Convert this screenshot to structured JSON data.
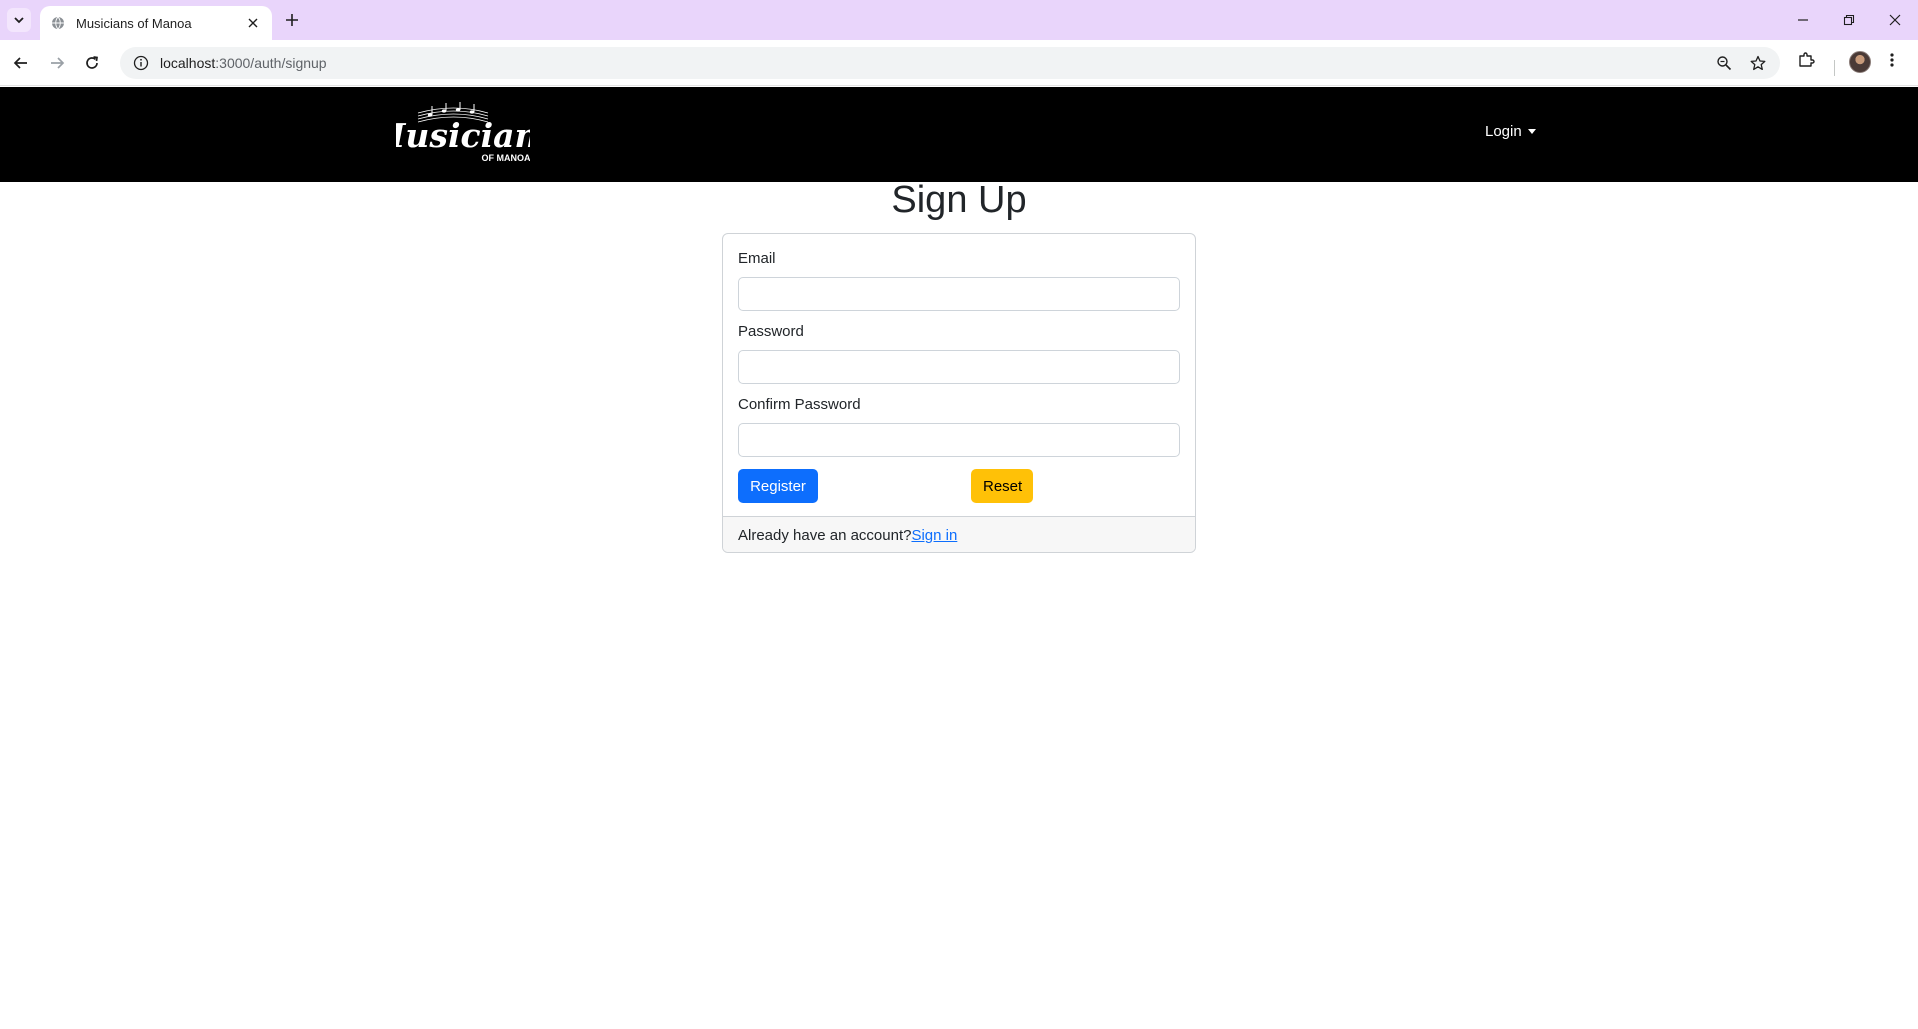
{
  "browser": {
    "tab_title": "Musicians of Manoa",
    "url_host": "localhost",
    "url_path": ":3000/auth/signup"
  },
  "navbar": {
    "brand_main": "Musicians",
    "brand_sub": "OF MANOA",
    "login_label": "Login"
  },
  "page": {
    "heading": "Sign Up"
  },
  "form": {
    "email_label": "Email",
    "email_value": "",
    "password_label": "Password",
    "password_value": "",
    "confirm_label": "Confirm Password",
    "confirm_value": "",
    "register_label": "Register",
    "reset_label": "Reset"
  },
  "footer": {
    "prompt": "Already have an account?",
    "signin_link": "Sign in"
  },
  "colors": {
    "tabbar": "#e9d5fb",
    "navbar": "#000000",
    "primary": "#0d6efd",
    "warning": "#ffc107"
  }
}
